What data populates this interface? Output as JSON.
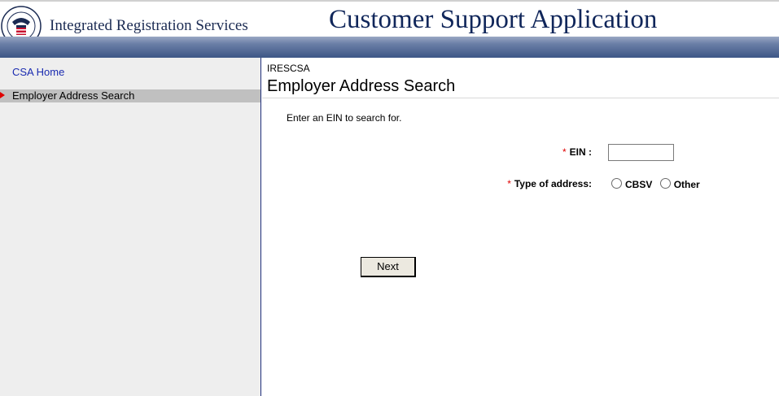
{
  "header": {
    "brand": "Integrated Registration Services",
    "app_title": "Customer Support Application",
    "seal_text": "SOCIAL SECURITY ADMINISTRATION",
    "seal_center": "USA"
  },
  "sidebar": {
    "items": [
      {
        "label": "CSA Home",
        "state": "link"
      },
      {
        "label": "Employer Address Search",
        "state": "active"
      }
    ]
  },
  "main": {
    "breadcrumb": "IRESCSA",
    "title": "Employer Address Search",
    "instructions": "Enter an EIN to search for.",
    "form": {
      "ein": {
        "label": "EIN :",
        "required_marker": "*",
        "value": ""
      },
      "address_type": {
        "label": "Type of address:",
        "required_marker": "*",
        "options": [
          "CBSV",
          "Other"
        ],
        "selected": null
      },
      "next_label": "Next"
    }
  },
  "colors": {
    "header_band": "#3d5686",
    "title_text": "#10265a",
    "link": "#1a2bb0",
    "required": "#e00000",
    "sidebar_bg": "#eeeeee",
    "active_item_bg": "#c0c0c0"
  }
}
